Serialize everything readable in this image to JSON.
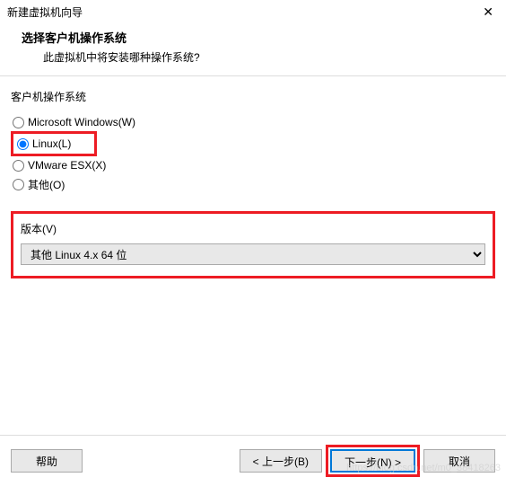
{
  "titlebar": {
    "title": "新建虚拟机向导"
  },
  "header": {
    "title": "选择客户机操作系统",
    "subtitle": "此虚拟机中将安装哪种操作系统?"
  },
  "os_group": {
    "label": "客户机操作系统",
    "options": [
      {
        "label": "Microsoft Windows(W)",
        "checked": false
      },
      {
        "label": "Linux(L)",
        "checked": true
      },
      {
        "label": "VMware ESX(X)",
        "checked": false
      },
      {
        "label": "其他(O)",
        "checked": false
      }
    ]
  },
  "version": {
    "label": "版本(V)",
    "selected": "其他 Linux 4.x 64 位"
  },
  "footer": {
    "help": "帮助",
    "back": "< 上一步(B)",
    "next": "下一步(N) >",
    "cancel": "取消"
  },
  "watermark": "https://blog.csdn.net/m0_38418263"
}
